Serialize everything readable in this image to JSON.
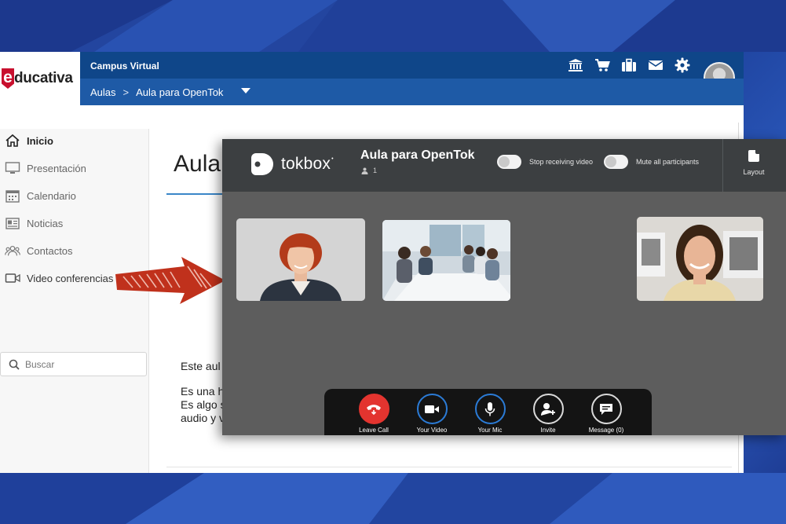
{
  "colors": {
    "header_dark": "#0f4689",
    "header_light": "#1e5aa6",
    "brand_red": "#c8102e",
    "tokbox_header": "#3c3f41",
    "tokbox_body": "#5d5d5d",
    "leave_red": "#e3342f",
    "active_blue": "#2b7bd6",
    "arrow_red": "#c0311c"
  },
  "lms": {
    "logo": {
      "mark": "e",
      "text": "ducativa"
    },
    "header": {
      "site_title": "Campus Virtual",
      "breadcrumb": [
        "Aulas",
        "Aula para OpenTok"
      ],
      "breadcrumb_separator": ">",
      "icons": [
        "institution-icon",
        "cart-icon",
        "briefcase-icon",
        "mail-icon",
        "gear-icon"
      ]
    },
    "sidebar": {
      "items": [
        {
          "label": "Inicio",
          "icon": "home-icon",
          "active": true
        },
        {
          "label": "Presentación",
          "icon": "monitor-icon",
          "active": false
        },
        {
          "label": "Calendario",
          "icon": "calendar-icon",
          "active": false
        },
        {
          "label": "Noticias",
          "icon": "newspaper-icon",
          "active": false
        },
        {
          "label": "Contactos",
          "icon": "contacts-icon",
          "active": false
        },
        {
          "label": "Video conferencias",
          "icon": "video-camera-icon",
          "active": false
        }
      ],
      "search": {
        "placeholder": "Buscar",
        "icon": "search-icon"
      }
    },
    "main": {
      "title": "Aula",
      "paragraphs": [
        "Este aul",
        "Es una h",
        "Es algo s",
        "audio y v"
      ]
    }
  },
  "tokbox": {
    "brand": "tokbox",
    "brand_mark": "•",
    "room_name": "Aula para OpenTok",
    "participant_count": "1",
    "toggles": [
      {
        "label": "Stop receiving video",
        "on": false
      },
      {
        "label": "Mute all participants",
        "on": false
      }
    ],
    "layout_label": "Layout",
    "controls": [
      {
        "label": "Leave Call",
        "icon": "hang-up-icon"
      },
      {
        "label": "Your Video",
        "icon": "video-camera-icon"
      },
      {
        "label": "Your Mic",
        "icon": "microphone-icon"
      },
      {
        "label": "Invite",
        "icon": "add-user-icon"
      },
      {
        "label": "Message (0)",
        "icon": "chat-icon"
      }
    ]
  }
}
